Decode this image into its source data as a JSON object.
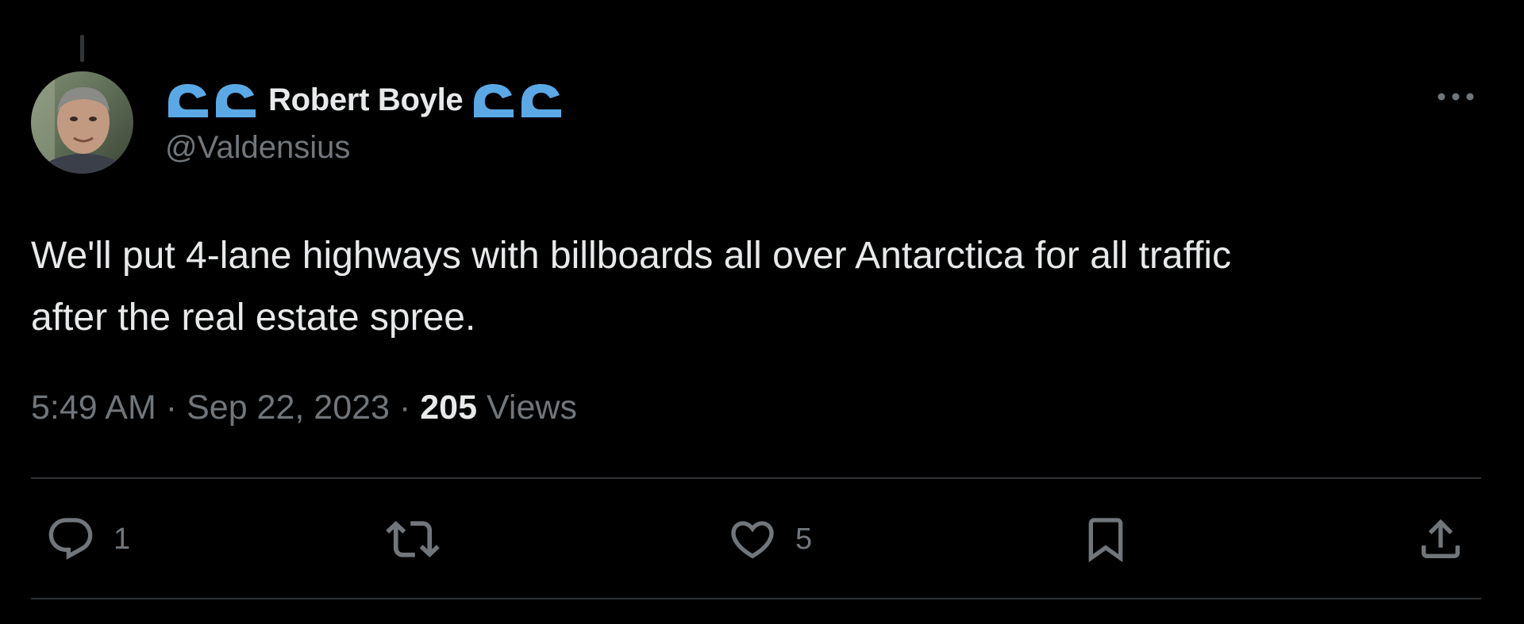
{
  "tweet": {
    "author": {
      "display_name": "Robert Boyle",
      "handle": "@Valdensius",
      "name_emoji": "water-wave-icon"
    },
    "text": "We'll put 4-lane highways with billboards all over Antarctica for all traffic\nafter the real estate spree.",
    "timestamp": {
      "time": "5:49 AM",
      "separator": "·",
      "date": "Sep 22, 2023"
    },
    "views": {
      "count": "205",
      "label": "Views"
    },
    "actions": {
      "reply": {
        "icon": "reply-icon",
        "count": "1"
      },
      "retweet": {
        "icon": "retweet-icon",
        "count": ""
      },
      "like": {
        "icon": "heart-icon",
        "count": "5"
      },
      "bookmark": {
        "icon": "bookmark-icon"
      },
      "share": {
        "icon": "share-icon"
      }
    },
    "more_icon": "more-icon"
  },
  "colors": {
    "background": "#000000",
    "primary_text": "#e7e9ea",
    "secondary_text": "#71767b",
    "divider": "#2f3336",
    "wave_emoji": "#5aa9e6"
  }
}
